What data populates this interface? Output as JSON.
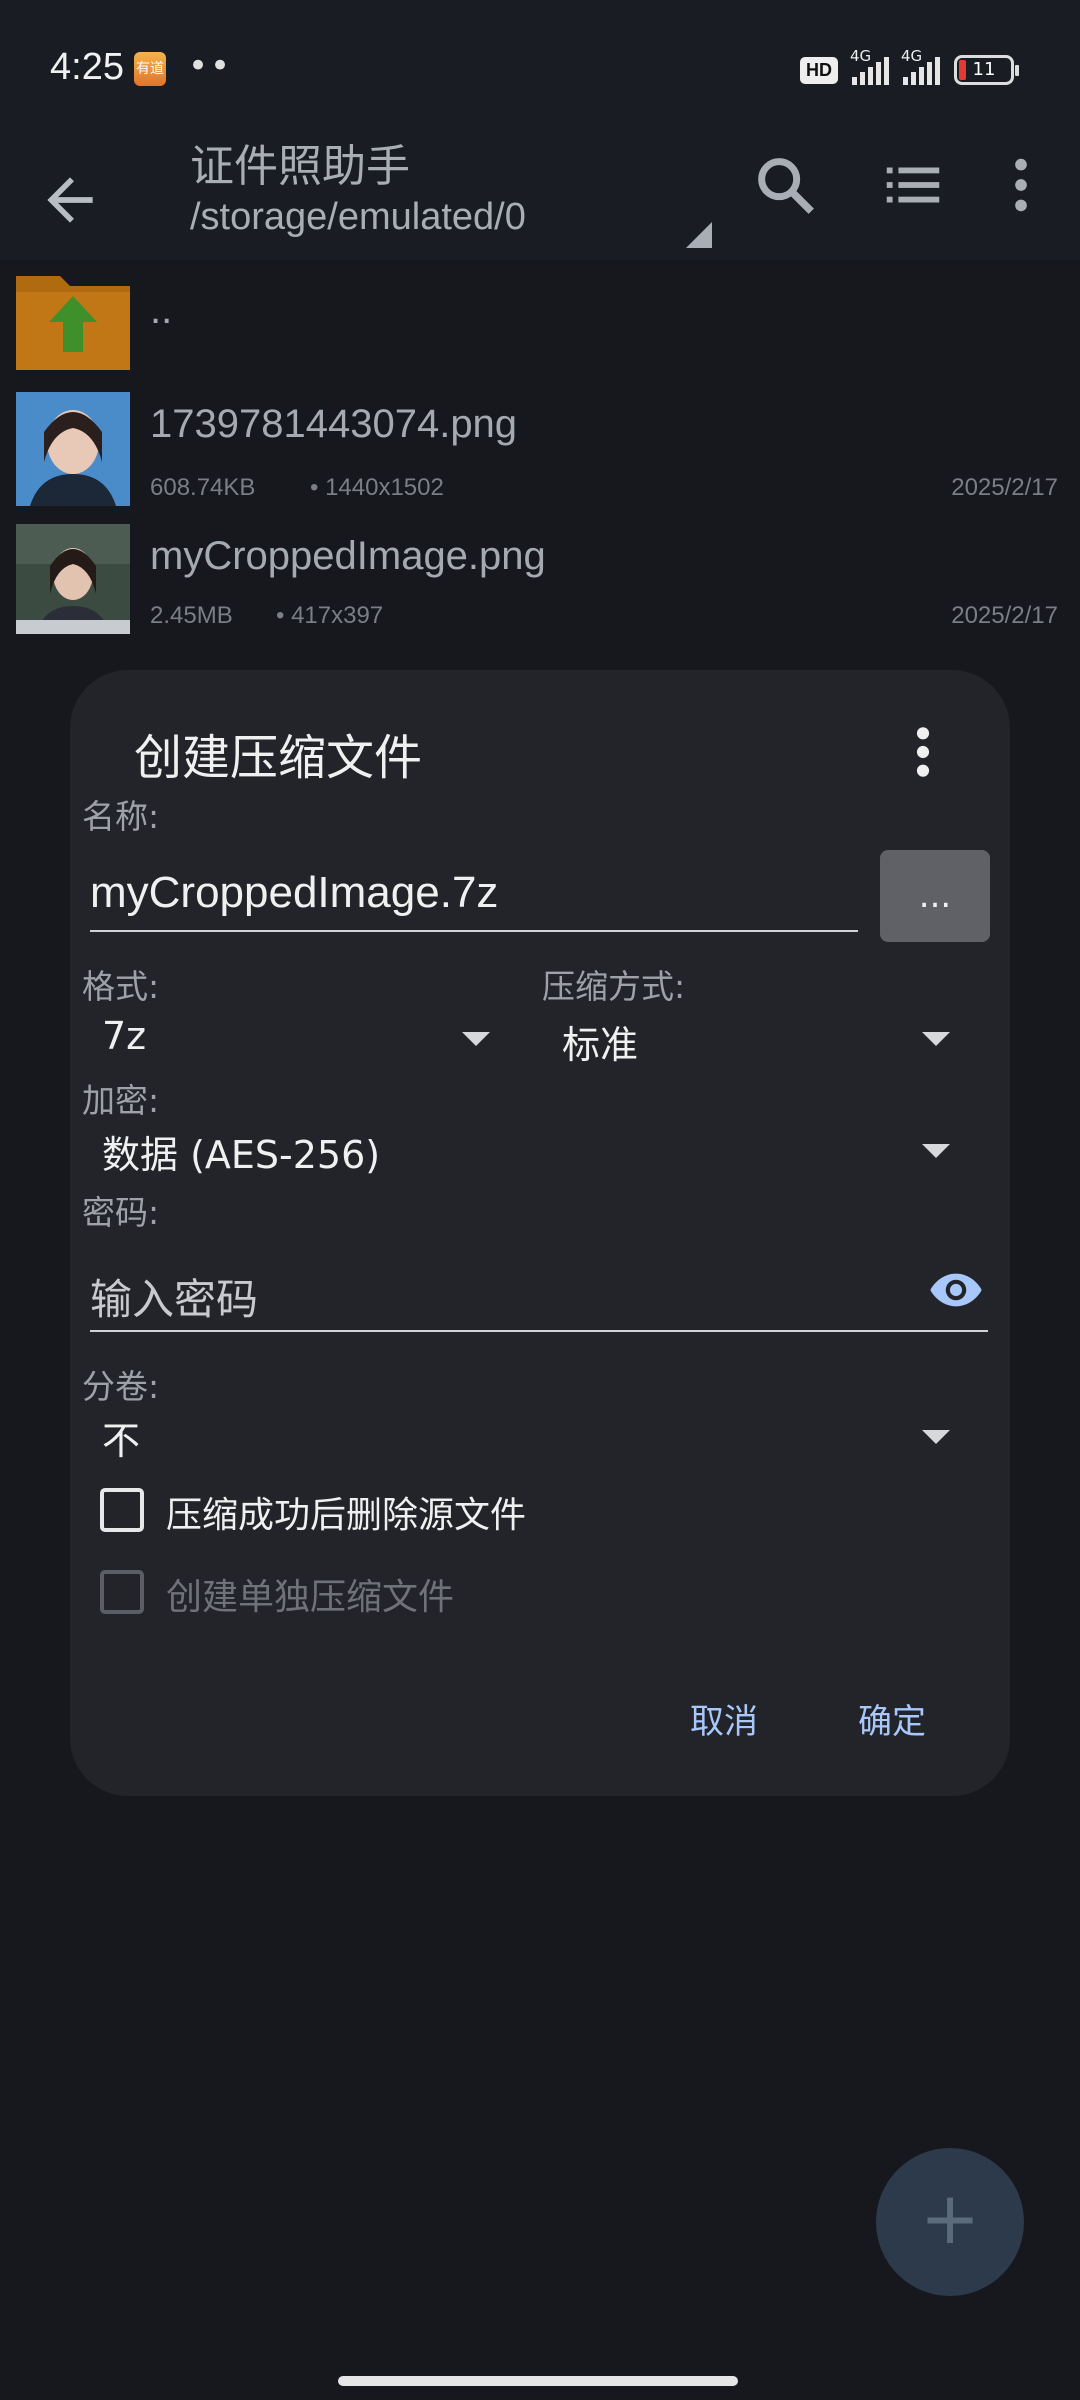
{
  "status": {
    "time": "4:25",
    "app_icon_text": "有道",
    "dots": "••",
    "hd": "HD",
    "net1": "4G",
    "net2": "4G",
    "battery": "11"
  },
  "appbar": {
    "title": "证件照助手",
    "path": "/storage/emulated/0"
  },
  "files": [
    {
      "name": "..",
      "size": "",
      "dims": "",
      "date": ""
    },
    {
      "name": "1739781443074.png",
      "size": "608.74KB",
      "dims": "• 1440x1502",
      "date": "2025/2/17"
    },
    {
      "name": "myCroppedImage.png",
      "size": "2.45MB",
      "dims": "• 417x397",
      "date": "2025/2/17"
    }
  ],
  "dialog": {
    "title": "创建压缩文件",
    "name_label": "名称:",
    "name_value": "myCroppedImage.7z",
    "browse_label": "...",
    "format_label": "格式:",
    "format_value": "7z",
    "method_label": "压缩方式:",
    "method_value": "标准",
    "encrypt_label": "加密:",
    "encrypt_value": "数据 (AES-256)",
    "password_label": "密码:",
    "password_placeholder": "输入密码",
    "volume_label": "分卷:",
    "volume_value": "不",
    "delete_source_label": "压缩成功后删除源文件",
    "separate_label": "创建单独压缩文件",
    "cancel": "取消",
    "ok": "确定"
  },
  "fab": "+"
}
